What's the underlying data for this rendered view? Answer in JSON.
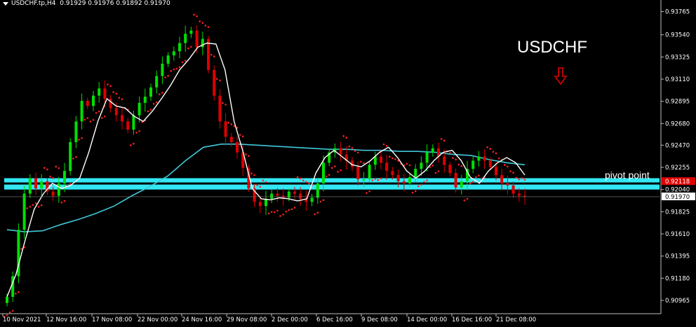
{
  "header": {
    "instrument": "USDCHF.tp,H4",
    "quotes": "0.91929 0.91976 0.91892 0.91970"
  },
  "symbol_title": "USDCHF",
  "pivot_label": "pivot point",
  "colors": {
    "background": "#000000",
    "bull": "#00e000",
    "bear": "#e00000",
    "parabolic_sar": "#ff2020",
    "ma_fast": "#ffffff",
    "ma_slow": "#40c8d8",
    "pivot_band": "#33e8f5",
    "axis": "#c0c0c0",
    "current_price_box": "#ffffff",
    "pivot_price_box": "#e00000",
    "down_arrow": "#e00000"
  },
  "icons": {
    "menu_triangle": "down-triangle",
    "down_arrow": "hollow-down-arrow"
  },
  "chart_data": {
    "type": "candlestick",
    "title": "USDCHF",
    "timeframe": "H4",
    "ylim": [
      0.9085,
      0.9385
    ],
    "y_ticks": [
      "0.93765",
      "0.93540",
      "0.93325",
      "0.93110",
      "0.92895",
      "0.92680",
      "0.92470",
      "0.92255",
      "0.92040",
      "0.91825",
      "0.91610",
      "0.91395",
      "0.91180",
      "0.90965"
    ],
    "x_ticks": [
      "10 Nov 2021",
      "12 Nov 16:00",
      "17 Nov 08:00",
      "22 Nov 00:00",
      "24 Nov 16:00",
      "29 Nov 08:00",
      "2 Dec 00:00",
      "6 Dec 16:00",
      "9 Dec 08:00",
      "14 Dec 00:00",
      "16 Dec 16:00",
      "21 Dec 08:00"
    ],
    "current_price": "0.91970",
    "pivot_price": "0.92118",
    "pivot_zone": {
      "high": 0.9215,
      "low": 0.9204
    },
    "grid": false,
    "close_series": [
      0.91,
      0.912,
      0.9165,
      0.92,
      0.9215,
      0.9205,
      0.9212,
      0.9202,
      0.9198,
      0.921,
      0.9222,
      0.925,
      0.927,
      0.929,
      0.9285,
      0.9295,
      0.9302,
      0.9292,
      0.9283,
      0.9276,
      0.927,
      0.9262,
      0.9276,
      0.9288,
      0.9294,
      0.9303,
      0.9314,
      0.9326,
      0.9334,
      0.9338,
      0.9346,
      0.9355,
      0.9358,
      0.9342,
      0.935,
      0.932,
      0.9295,
      0.927,
      0.9255,
      0.925,
      0.924,
      0.9225,
      0.9205,
      0.9192,
      0.9188,
      0.9195,
      0.92,
      0.9198,
      0.9196,
      0.9202,
      0.92,
      0.9195,
      0.9192,
      0.9196,
      0.921,
      0.923,
      0.924,
      0.9244,
      0.9238,
      0.9232,
      0.9226,
      0.9214,
      0.9214,
      0.9228,
      0.9236,
      0.923,
      0.9222,
      0.9218,
      0.9212,
      0.921,
      0.9216,
      0.9224,
      0.923,
      0.924,
      0.9244,
      0.9236,
      0.9228,
      0.922,
      0.9206,
      0.9212,
      0.9224,
      0.9232,
      0.9236,
      0.9232,
      0.9226,
      0.9218,
      0.921,
      0.9208,
      0.92,
      0.9198,
      0.9197
    ],
    "series": [
      {
        "name": "MA fast",
        "color": "#ffffff",
        "values": [
          0.91,
          0.9122,
          0.9155,
          0.9185,
          0.92,
          0.921,
          0.9205,
          0.9208,
          0.9215,
          0.924,
          0.927,
          0.9292,
          0.9285,
          0.9283,
          0.9275,
          0.927,
          0.928,
          0.9292,
          0.9305,
          0.932,
          0.933,
          0.9342,
          0.9346,
          0.9345,
          0.932,
          0.927,
          0.924,
          0.9205,
          0.9195,
          0.9194,
          0.9196,
          0.9195,
          0.9193,
          0.9195,
          0.922,
          0.9235,
          0.9242,
          0.9235,
          0.9228,
          0.9226,
          0.9232,
          0.924,
          0.9245,
          0.9235,
          0.9222,
          0.9215,
          0.9222,
          0.9232,
          0.924,
          0.9242,
          0.9232,
          0.9216,
          0.921,
          0.9222,
          0.923,
          0.9235,
          0.923,
          0.9218
        ]
      },
      {
        "name": "MA slow",
        "color": "#40c8d8",
        "values": [
          0.9165,
          0.9163,
          0.9164,
          0.917,
          0.9175,
          0.9181,
          0.9188,
          0.9198,
          0.9207,
          0.9217,
          0.9232,
          0.9245,
          0.9248,
          0.9248,
          0.9247,
          0.9246,
          0.9245,
          0.9244,
          0.9243,
          0.9243,
          0.9242,
          0.9242,
          0.9241,
          0.9241,
          0.924,
          0.9238,
          0.9237,
          0.9233,
          0.923,
          0.9228
        ]
      }
    ]
  }
}
